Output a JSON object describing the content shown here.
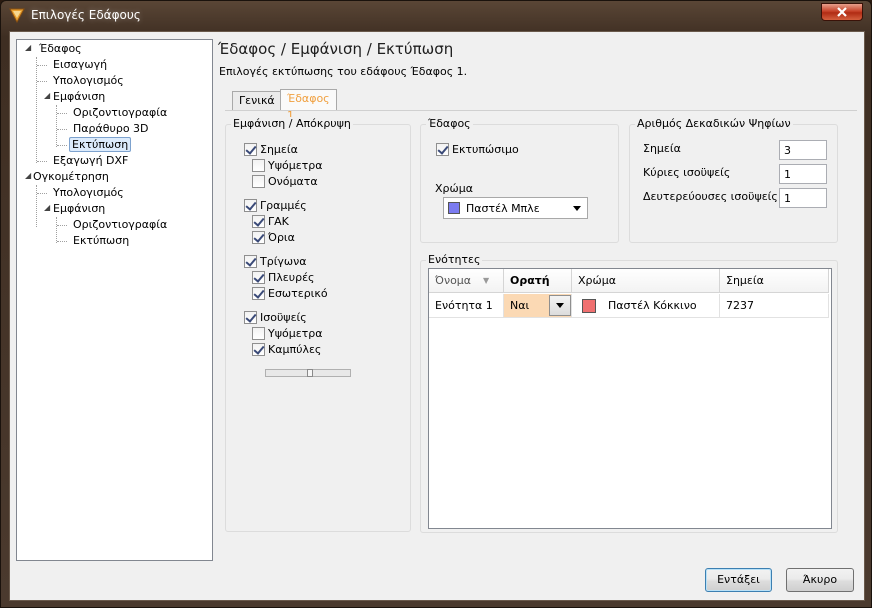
{
  "window": {
    "title": "Επιλογές Εδάφους"
  },
  "tree": {
    "nodes": [
      {
        "label": "Έδαφος"
      },
      {
        "label": "Εισαγωγή"
      },
      {
        "label": "Υπολογισμός"
      },
      {
        "label": "Εμφάνιση"
      },
      {
        "label": "Οριζοντιογραφία"
      },
      {
        "label": "Παράθυρο 3D"
      },
      {
        "label": "Εκτύπωση"
      },
      {
        "label": "Εξαγωγή DXF"
      },
      {
        "label": "Ογκομέτρηση"
      },
      {
        "label": "Υπολογισμός"
      },
      {
        "label": "Εμφάνιση"
      },
      {
        "label": "Οριζοντιογραφία"
      },
      {
        "label": "Εκτύπωση"
      }
    ]
  },
  "header": {
    "title": "Έδαφος / Εμφάνιση / Εκτύπωση",
    "subtitle": "Επιλογές εκτύπωσης του εδάφους Έδαφος 1."
  },
  "tabs": [
    {
      "label": "Γενικά"
    },
    {
      "label": "Έδαφος 1"
    }
  ],
  "visibility": {
    "title": "Εμφάνιση / Απόκρυψη",
    "items": [
      {
        "label": "Σημεία",
        "checked": true
      },
      {
        "label": "Υψόμετρα",
        "checked": false
      },
      {
        "label": "Ονόματα",
        "checked": false
      },
      {
        "label": "Γραμμές",
        "checked": true
      },
      {
        "label": "ΓΑΚ",
        "checked": true
      },
      {
        "label": "Όρια",
        "checked": true
      },
      {
        "label": "Τρίγωνα",
        "checked": true
      },
      {
        "label": "Πλευρές",
        "checked": true
      },
      {
        "label": "Εσωτερικό",
        "checked": true
      },
      {
        "label": "Ισοϋψείς",
        "checked": true
      },
      {
        "label": "Υψόμετρα",
        "checked": false
      },
      {
        "label": "Καμπύλες",
        "checked": true
      }
    ]
  },
  "terrain": {
    "title": "Έδαφος",
    "printable_label": "Εκτυπώσιμο",
    "printable_checked": true,
    "color_label": "Χρώμα",
    "color_value": "Παστέλ Μπλε",
    "color_hex": "#7b7bf0"
  },
  "decimals": {
    "title": "Αριθμός Δεκαδικών Ψηφίων",
    "rows": [
      {
        "label": "Σημεία",
        "value": "3"
      },
      {
        "label": "Κύριες ισοϋψείς",
        "value": "1"
      },
      {
        "label": "Δευτερεύουσες ισοϋψείς",
        "value": "1"
      }
    ]
  },
  "units": {
    "title": "Ενότητες",
    "columns": [
      "Όνομα",
      "Ορατή",
      "Χρώμα",
      "Σημεία"
    ],
    "rows": [
      {
        "name": "Ενότητα 1",
        "visible": "Ναι",
        "color": "Παστέλ Κόκκινο",
        "color_hex": "#f07070",
        "points": "7237"
      }
    ]
  },
  "buttons": {
    "ok": "Εντάξει",
    "cancel": "Άκυρο"
  }
}
